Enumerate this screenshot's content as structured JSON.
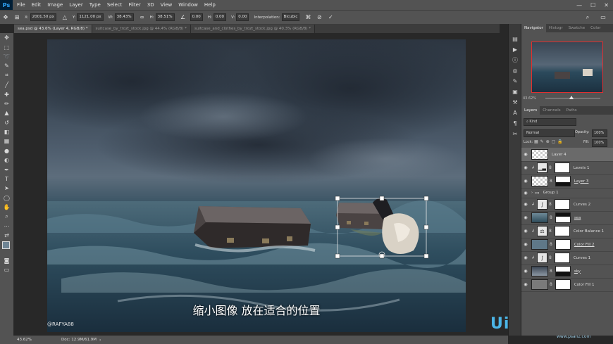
{
  "app": {
    "logo": "Ps"
  },
  "menu": [
    "File",
    "Edit",
    "Image",
    "Layer",
    "Type",
    "Select",
    "Filter",
    "3D",
    "View",
    "Window",
    "Help"
  ],
  "options": {
    "x_label": "X:",
    "x_value": "2001.50 px",
    "y_label": "Y:",
    "y_value": "1121.00 px",
    "w_label": "W:",
    "w_value": "38.43%",
    "h_label": "H:",
    "h_value": "38.51%",
    "angle_value": "0.00",
    "hskew_label": "H:",
    "hskew_value": "0.00",
    "vskew_label": "V:",
    "vskew_value": "0.00",
    "interp_label": "Interpolation:",
    "interp_value": "Bicubic"
  },
  "tabs": [
    {
      "label": "sea.psd @ 43.6% (Layer 4, RGB/8) *",
      "active": true
    },
    {
      "label": "suitcase_by_trozt_stock.jpg @ 44.4% (RGB/8) *",
      "active": false
    },
    {
      "label": "suitcase_and_clothes_by_trozt_stock.jpg @ 40.3% (RGB/8) *",
      "active": false
    }
  ],
  "canvas": {
    "subtitle": "缩小图像  放在适合的位置",
    "watermark": "@RAFYA88",
    "site_logo": "UiBQ.CoM",
    "site_sub": "www.psahz.com"
  },
  "navigator": {
    "tabs": [
      "Navigator",
      "Histogr",
      "Swatche",
      "Color"
    ],
    "zoom": "43.62%"
  },
  "layers_panel": {
    "tabs": [
      "Layers",
      "Channels",
      "Paths"
    ],
    "kind_placeholder": "Kind",
    "blend_mode": "Normal",
    "opacity_label": "Opacity:",
    "opacity": "100%",
    "lock_label": "Lock:",
    "fill_label": "Fill:",
    "fill": "100%",
    "layers": [
      {
        "name": "Layer 4",
        "selected": true
      },
      {
        "name": "Levels 1"
      },
      {
        "name": "Layer 3"
      },
      {
        "name": "Group 1"
      },
      {
        "name": "Curves 2"
      },
      {
        "name": "sea"
      },
      {
        "name": "Color Balance 1"
      },
      {
        "name": "Color Fill 2"
      },
      {
        "name": "Curves 1"
      },
      {
        "name": "sky"
      },
      {
        "name": "Color Fill 1"
      }
    ]
  },
  "status": {
    "zoom": "43.62%",
    "doc": "Doc: 12.9M/61.9M"
  },
  "colors": {
    "accent": "#31a8ff",
    "panel": "#535353",
    "dark": "#282828",
    "selected_layer": "#6a6a6a"
  }
}
